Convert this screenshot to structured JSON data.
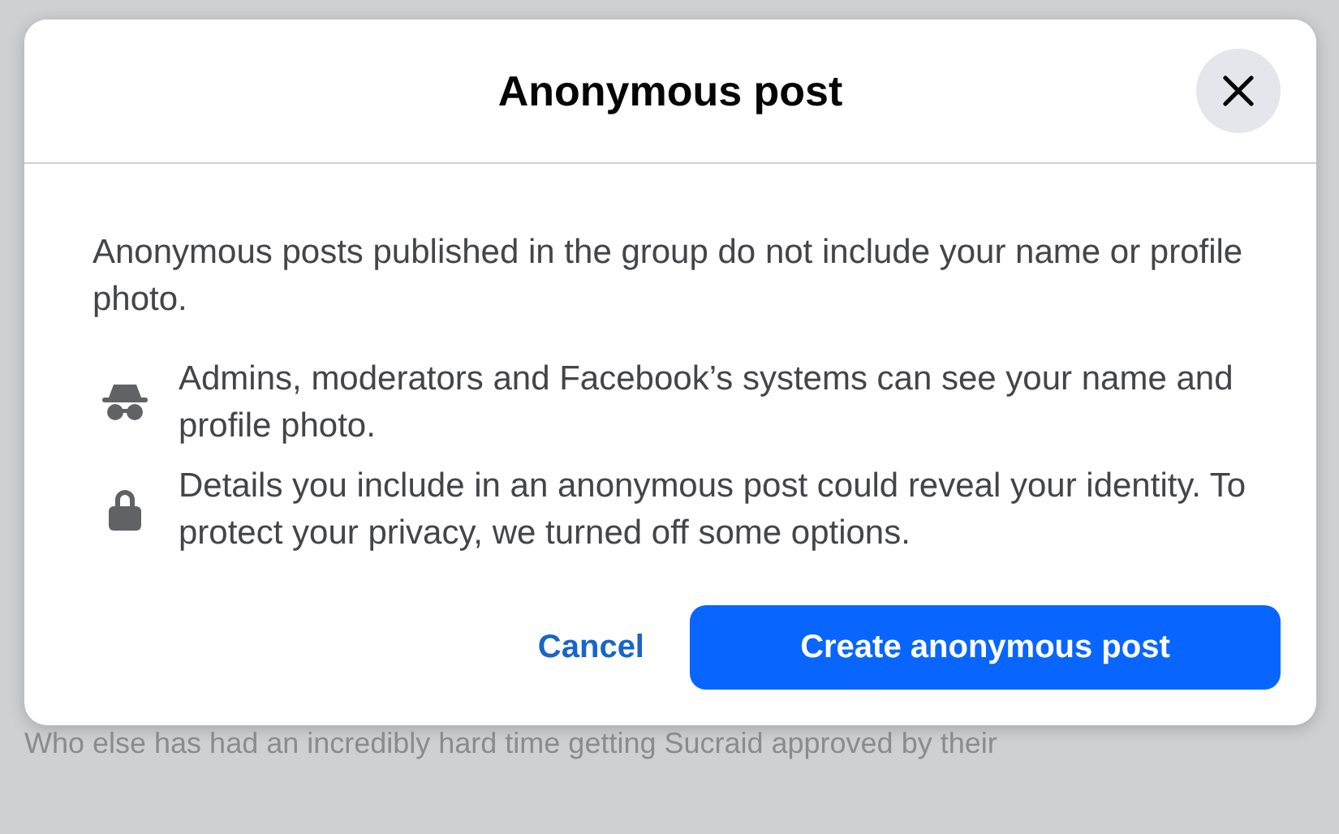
{
  "dialog": {
    "title": "Anonymous post",
    "intro": "Anonymous posts published in the group do not include your name or profile photo.",
    "notes": [
      {
        "kind": "incognito",
        "text": "Admins, moderators and Facebook’s systems can see your name and profile photo."
      },
      {
        "kind": "lock",
        "text": "Details you include in an anonymous post could reveal your identity. To protect your privacy, we turned off some options."
      }
    ],
    "cancel": "Cancel",
    "confirm": "Create anonymous post"
  },
  "background_post": {
    "text": "Who else has had an incredibly hard time getting Sucraid approved by their"
  }
}
